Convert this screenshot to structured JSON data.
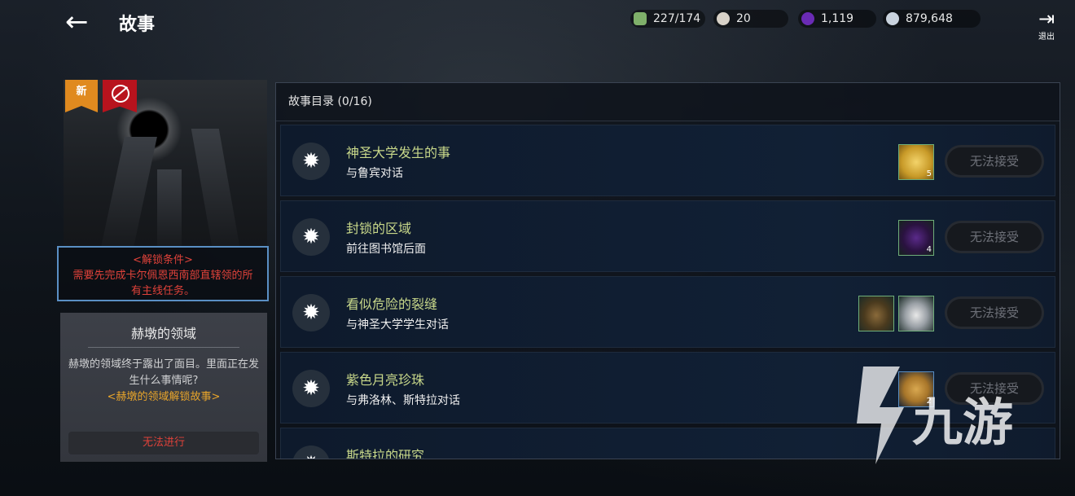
{
  "header": {
    "title": "故事",
    "resources": [
      {
        "icon": "stamina-icon",
        "value": "227/174",
        "color": "#7fb06a"
      },
      {
        "icon": "pearl-icon",
        "value": "20",
        "color": "#d8d2c8"
      },
      {
        "icon": "purple-orb-icon",
        "value": "1,119",
        "color": "#6a2bb5"
      },
      {
        "icon": "silver-coin-icon",
        "value": "879,648",
        "color": "#c9d3de"
      }
    ],
    "exit_label": "退出"
  },
  "story_card": {
    "badge_new": "新",
    "unlock_condition_title": "<解锁条件>",
    "unlock_condition_text": "需要先完成卡尔佩恩西南部直辖领的所有主线任务。",
    "name": "赫墩的领域",
    "description": "赫墩的领域终于露出了面目。里面正在发生什么事情呢?",
    "description_highlight": "<赫墩的领域解锁故事>",
    "action_label": "无法进行"
  },
  "catalog": {
    "header": "故事目录 (0/16)",
    "items": [
      {
        "name": "神圣大学发生的事",
        "sub": "与鲁宾对话",
        "button": "无法接受",
        "rewards": [
          {
            "icon": "gold-coin-icon",
            "count": "5"
          }
        ]
      },
      {
        "name": "封锁的区域",
        "sub": "前往图书馆后面",
        "button": "无法接受",
        "rewards": [
          {
            "icon": "purple-crystal-icon",
            "count": "4"
          }
        ]
      },
      {
        "name": "看似危险的裂缝",
        "sub": "与神圣大学学生对话",
        "button": "无法接受",
        "rewards": [
          {
            "icon": "turtle-shell-icon",
            "count": ""
          },
          {
            "icon": "milk-can-icon",
            "count": ""
          }
        ]
      },
      {
        "name": "紫色月亮珍珠",
        "sub": "与弗洛林、斯特拉对话",
        "button": "无法接受",
        "rewards": [
          {
            "icon": "backpack-icon",
            "count": "2"
          }
        ]
      },
      {
        "name": "斯特拉的研究",
        "sub": "",
        "button": "",
        "rewards": []
      }
    ]
  },
  "watermark": "九游"
}
